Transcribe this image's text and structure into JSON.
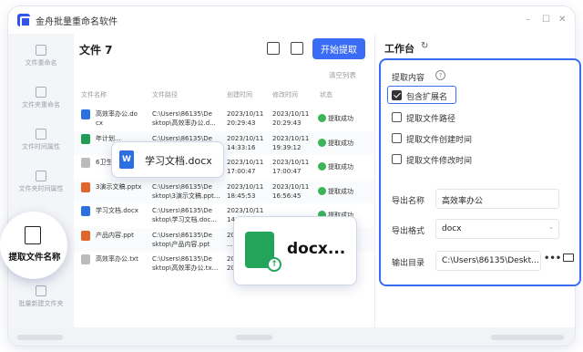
{
  "app": {
    "title": "金舟批量重命名软件"
  },
  "sidebar": {
    "items": [
      {
        "label": "文件重命名"
      },
      {
        "label": "文件夹重命名"
      },
      {
        "label": "文件时间属性"
      },
      {
        "label": "文件夹时间属性"
      },
      {
        "label": "提取文件名称"
      },
      {
        "label": "批量新建文件夹"
      }
    ]
  },
  "main": {
    "files_title": "文件 7",
    "start_label": "开始提取",
    "clear_label": "清空列表",
    "columns": {
      "name": "文件名称",
      "path": "文件路径",
      "created": "创建时间",
      "modified": "修改时间",
      "status": "状态"
    },
    "rows": [
      {
        "name": "高效率办公.do\ncx",
        "path": "C:\\Users\\86135\\De\nsktop\\高效率办公.d...",
        "created": "2023/10/11\n20:29:43",
        "modified": "2023/10/11\n20:29:43",
        "status": "提取成功",
        "icon_color": "#2b6fe0"
      },
      {
        "name": "年计划...",
        "path": "C:\\Users\\86135\\De\nsktop\\...",
        "created": "2023/10/11\n14:33:16",
        "modified": "2023/10/11\n19:39:12",
        "status": "提取成功",
        "icon_color": "#1f9d55"
      },
      {
        "name": "6卫生...",
        "path": "",
        "created": "2023/10/11\n17:00:47",
        "modified": "2023/10/11\n17:00:47",
        "status": "提取成功",
        "icon_color": "#bbbbbb"
      },
      {
        "name": "3演示文稿.pptx",
        "path": "C:\\Users\\86135\\De\nsktop\\3演示文稿.ppt...",
        "created": "2023/10/11\n18:45:53",
        "modified": "2023/10/11\n16:56:45",
        "status": "提取成功",
        "icon_color": "#e0662b"
      },
      {
        "name": "学习文档.docx",
        "path": "C:\\Users\\86135\\De\nsktop\\学习文档.doc...",
        "created": "2023/10/11\n14:33:16",
        "modified": "",
        "status": "提取成功",
        "icon_color": "#2b6fe0"
      },
      {
        "name": "产品内容.ppt",
        "path": "C:\\Users\\86135\\De\nsktop\\产品内容.ppt",
        "created": "2023/10/11\n...",
        "modified": "",
        "status": "",
        "icon_color": "#e0662b"
      },
      {
        "name": "高效率办公.txt",
        "path": "C:\\Users\\86135\\De\nsktop\\高效率办公.tx...",
        "created": "2023/10/11\n20:29:43",
        "modified": "",
        "status": "",
        "icon_color": "#bbbbbb"
      }
    ]
  },
  "workbench": {
    "title": "工作台",
    "extract_label": "提取内容",
    "options": [
      {
        "label": "包含扩展名",
        "checked": true
      },
      {
        "label": "提取文件路径",
        "checked": false
      },
      {
        "label": "提取文件创建时间",
        "checked": false
      },
      {
        "label": "提取文件修改时间",
        "checked": false
      }
    ],
    "export_name_label": "导出名称",
    "export_name": "高效率办公",
    "export_format_label": "导出格式",
    "export_format": "docx",
    "output_dir_label": "输出目录",
    "output_dir": "C:\\Users\\86135\\Deskt..."
  },
  "popups": {
    "word": "学习文档.docx",
    "docx": "docx..."
  }
}
